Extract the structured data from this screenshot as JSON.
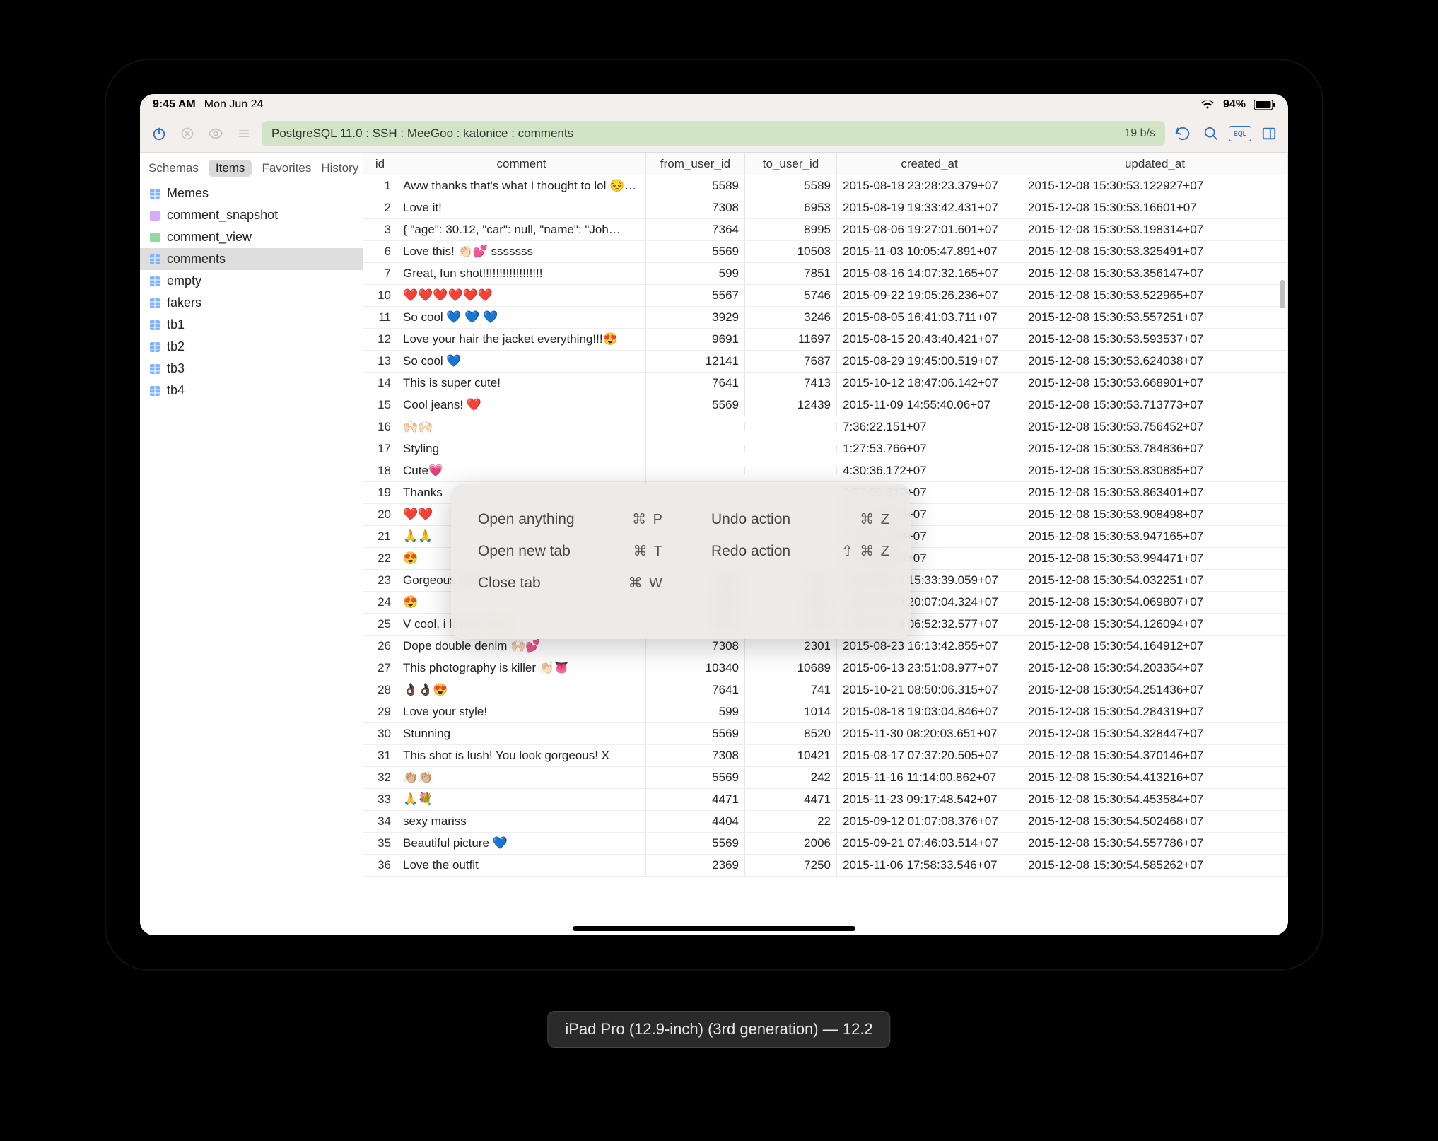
{
  "statusbar": {
    "time": "9:45 AM",
    "date": "Mon Jun 24",
    "battery": "94%"
  },
  "path": "PostgreSQL 11.0 : SSH : MeeGoo : katonice : comments",
  "rate": "19 b/s",
  "sidebar_tabs": {
    "schemas": "Schemas",
    "items": "Items",
    "favorites": "Favorites",
    "history": "History"
  },
  "sidebar_items": [
    {
      "label": "Memes",
      "type": "table"
    },
    {
      "label": "comment_snapshot",
      "type": "snap"
    },
    {
      "label": "comment_view",
      "type": "view"
    },
    {
      "label": "comments",
      "type": "table",
      "selected": true
    },
    {
      "label": "empty",
      "type": "table"
    },
    {
      "label": "fakers",
      "type": "table"
    },
    {
      "label": "tb1",
      "type": "table"
    },
    {
      "label": "tb2",
      "type": "table"
    },
    {
      "label": "tb3",
      "type": "table"
    },
    {
      "label": "tb4",
      "type": "table"
    }
  ],
  "columns": {
    "id": "id",
    "comment": "comment",
    "from": "from_user_id",
    "to": "to_user_id",
    "created": "created_at",
    "updated": "updated_at"
  },
  "rows": [
    {
      "id": "1",
      "comment": "Aww thanks that's what I thought to lol 😔…",
      "from": "5589",
      "to": "5589",
      "created": "2015-08-18 23:28:23.379+07",
      "updated": "2015-12-08 15:30:53.122927+07"
    },
    {
      "id": "2",
      "comment": "Love it!",
      "from": "7308",
      "to": "6953",
      "created": "2015-08-19 19:33:42.431+07",
      "updated": "2015-12-08 15:30:53.16601+07"
    },
    {
      "id": "3",
      "comment": "{   \"age\": 30.12,   \"car\": null,   \"name\": \"Joh…",
      "from": "7364",
      "to": "8995",
      "created": "2015-08-06 19:27:01.601+07",
      "updated": "2015-12-08 15:30:53.198314+07"
    },
    {
      "id": "6",
      "comment": "Love this! 👏🏻💕 sssssss",
      "from": "5569",
      "to": "10503",
      "created": "2015-11-03 10:05:47.891+07",
      "updated": "2015-12-08 15:30:53.325491+07"
    },
    {
      "id": "7",
      "comment": "Great, fun shot!!!!!!!!!!!!!!!!!!",
      "from": "599",
      "to": "7851",
      "created": "2015-08-16 14:07:32.165+07",
      "updated": "2015-12-08 15:30:53.356147+07"
    },
    {
      "id": "10",
      "comment": "❤️❤️❤️❤️❤️❤️",
      "from": "5567",
      "to": "5746",
      "created": "2015-09-22 19:05:26.236+07",
      "updated": "2015-12-08 15:30:53.522965+07"
    },
    {
      "id": "11",
      "comment": "So cool 💙 💙 💙",
      "from": "3929",
      "to": "3246",
      "created": "2015-08-05 16:41:03.711+07",
      "updated": "2015-12-08 15:30:53.557251+07"
    },
    {
      "id": "12",
      "comment": "Love your hair the jacket everything!!!😍",
      "from": "9691",
      "to": "11697",
      "created": "2015-08-15 20:43:40.421+07",
      "updated": "2015-12-08 15:30:53.593537+07"
    },
    {
      "id": "13",
      "comment": "So cool 💙",
      "from": "12141",
      "to": "7687",
      "created": "2015-08-29 19:45:00.519+07",
      "updated": "2015-12-08 15:30:53.624038+07"
    },
    {
      "id": "14",
      "comment": "This is super cute!",
      "from": "7641",
      "to": "7413",
      "created": "2015-10-12 18:47:06.142+07",
      "updated": "2015-12-08 15:30:53.668901+07"
    },
    {
      "id": "15",
      "comment": "Cool jeans! ❤️",
      "from": "5569",
      "to": "12439",
      "created": "2015-11-09 14:55:40.06+07",
      "updated": "2015-12-08 15:30:53.713773+07"
    },
    {
      "id": "16",
      "comment": "🙌🏻🙌🏻",
      "from": "",
      "to": "",
      "created": "7:36:22.151+07",
      "updated": "2015-12-08 15:30:53.756452+07"
    },
    {
      "id": "17",
      "comment": "Styling",
      "from": "",
      "to": "",
      "created": "1:27:53.766+07",
      "updated": "2015-12-08 15:30:53.784836+07"
    },
    {
      "id": "18",
      "comment": "Cute💗",
      "from": "",
      "to": "",
      "created": "4:30:36.172+07",
      "updated": "2015-12-08 15:30:53.830885+07"
    },
    {
      "id": "19",
      "comment": "Thanks",
      "from": "",
      "to": "",
      "created": "2:27:05.312+07",
      "updated": "2015-12-08 15:30:53.863401+07"
    },
    {
      "id": "20",
      "comment": "❤️❤️",
      "from": "",
      "to": "",
      "created": "5:54:20.676+07",
      "updated": "2015-12-08 15:30:53.908498+07"
    },
    {
      "id": "21",
      "comment": "🙏🙏",
      "from": "",
      "to": "",
      "created": "1:08:02.183+07",
      "updated": "2015-12-08 15:30:53.947165+07"
    },
    {
      "id": "22",
      "comment": "😍",
      "from": "",
      "to": "",
      "created": "1:10:00.684+07",
      "updated": "2015-12-08 15:30:53.994471+07"
    },
    {
      "id": "23",
      "comment": "Gorgeous dress!",
      "from": "7308",
      "to": "7855",
      "created": "2015-08-16 15:33:39.059+07",
      "updated": "2015-12-08 15:30:54.032251+07"
    },
    {
      "id": "24",
      "comment": "😍",
      "from": "5569",
      "to": "5880",
      "created": "2015-09-09 20:07:04.324+07",
      "updated": "2015-12-08 15:30:54.069807+07"
    },
    {
      "id": "25",
      "comment": "V cool, i love it 😽😽",
      "from": "1002",
      "to": "5345",
      "created": "2015-08-19 06:52:32.577+07",
      "updated": "2015-12-08 15:30:54.126094+07"
    },
    {
      "id": "26",
      "comment": "Dope double denim 🙌🏻💕",
      "from": "7308",
      "to": "2301",
      "created": "2015-08-23 16:13:42.855+07",
      "updated": "2015-12-08 15:30:54.164912+07"
    },
    {
      "id": "27",
      "comment": "This photography is killer 👏🏻👅",
      "from": "10340",
      "to": "10689",
      "created": "2015-06-13 23:51:08.977+07",
      "updated": "2015-12-08 15:30:54.203354+07"
    },
    {
      "id": "28",
      "comment": "👌🏿👌🏿😍",
      "from": "7641",
      "to": "741",
      "created": "2015-10-21 08:50:06.315+07",
      "updated": "2015-12-08 15:30:54.251436+07"
    },
    {
      "id": "29",
      "comment": "Love your style!",
      "from": "599",
      "to": "1014",
      "created": "2015-08-18 19:03:04.846+07",
      "updated": "2015-12-08 15:30:54.284319+07"
    },
    {
      "id": "30",
      "comment": "Stunning",
      "from": "5569",
      "to": "8520",
      "created": "2015-11-30 08:20:03.651+07",
      "updated": "2015-12-08 15:30:54.328447+07"
    },
    {
      "id": "31",
      "comment": "This shot is lush! You look gorgeous! X",
      "from": "7308",
      "to": "10421",
      "created": "2015-08-17 07:37:20.505+07",
      "updated": "2015-12-08 15:30:54.370146+07"
    },
    {
      "id": "32",
      "comment": "👏🏼👏🏼",
      "from": "5569",
      "to": "242",
      "created": "2015-11-16 11:14:00.862+07",
      "updated": "2015-12-08 15:30:54.413216+07"
    },
    {
      "id": "33",
      "comment": "🙏💐",
      "from": "4471",
      "to": "4471",
      "created": "2015-11-23 09:17:48.542+07",
      "updated": "2015-12-08 15:30:54.453584+07"
    },
    {
      "id": "34",
      "comment": "sexy mariss",
      "from": "4404",
      "to": "22",
      "created": "2015-09-12 01:07:08.376+07",
      "updated": "2015-12-08 15:30:54.502468+07"
    },
    {
      "id": "35",
      "comment": "Beautiful picture 💙",
      "from": "5569",
      "to": "2006",
      "created": "2015-09-21 07:46:03.514+07",
      "updated": "2015-12-08 15:30:54.557786+07"
    },
    {
      "id": "36",
      "comment": "Love the outfit",
      "from": "2369",
      "to": "7250",
      "created": "2015-11-06 17:58:33.546+07",
      "updated": "2015-12-08 15:30:54.585262+07"
    }
  ],
  "popup": {
    "open_anything": "Open anything",
    "open_anything_sc": "⌘  P",
    "open_tab": "Open new tab",
    "open_tab_sc": "⌘  T",
    "close_tab": "Close tab",
    "close_tab_sc": "⌘  W",
    "undo": "Undo action",
    "undo_sc": "⌘  Z",
    "redo": "Redo action",
    "redo_sc": "⇧  ⌘  Z"
  },
  "device_label": "iPad Pro (12.9-inch) (3rd generation) — 12.2"
}
